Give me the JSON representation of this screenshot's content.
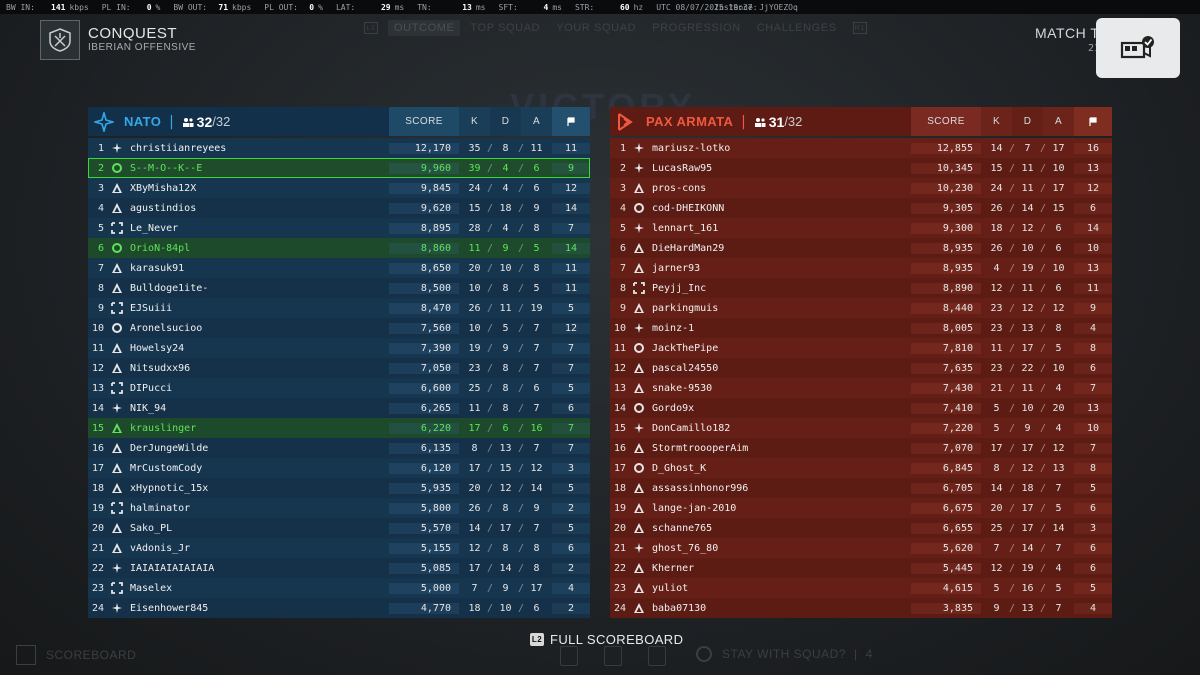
{
  "stats_bar": [
    {
      "label": "BW IN:",
      "value": "141",
      "unit": "kbps"
    },
    {
      "label": "PL IN:",
      "value": "0",
      "unit": "%"
    },
    {
      "label": "BW OUT:",
      "value": "71",
      "unit": "kbps"
    },
    {
      "label": "PL OUT:",
      "value": "0",
      "unit": "%"
    },
    {
      "label": "LAT:",
      "value": "29",
      "unit": "ms"
    },
    {
      "label": "TN:",
      "value": "13",
      "unit": "ms"
    },
    {
      "label": "SFT:",
      "value": "4",
      "unit": "ms"
    },
    {
      "label": "STR:",
      "value": "60",
      "unit": "hz"
    },
    {
      "label": "UTC 08/07/2025 19:37",
      "value": "",
      "unit": ""
    },
    {
      "label": "Instance:",
      "value": "",
      "unit": "JjYOEZOq"
    }
  ],
  "header": {
    "mode": "CONQUEST",
    "map": "IBERIAN OFFENSIVE",
    "match_time_label": "MATCH TI",
    "match_time_value": "21",
    "result": "VICTORY"
  },
  "tabs": [
    {
      "label": "OUTCOME",
      "active": true
    },
    {
      "label": "TOP SQUAD",
      "active": false
    },
    {
      "label": "YOUR SQUAD",
      "active": false
    },
    {
      "label": "PROGRESSION",
      "active": false
    },
    {
      "label": "CHALLENGES",
      "active": false
    }
  ],
  "columns": {
    "score": "SCORE",
    "k": "K",
    "d": "D",
    "a": "A"
  },
  "teams": {
    "nato": {
      "name": "NATO",
      "count_current": "32",
      "count_max": "/32",
      "accent": "#35a8ea",
      "players": [
        {
          "rank": "1",
          "name": "christiianreyees",
          "score": "12,170",
          "k": "35",
          "d": "8",
          "a": "11",
          "obj": "11",
          "cls": "support"
        },
        {
          "rank": "2",
          "name": "S--M-O--K--E",
          "score": "9,960",
          "k": "39",
          "d": "4",
          "a": "6",
          "obj": "9",
          "cls": "recon",
          "hl": "me"
        },
        {
          "rank": "3",
          "name": "XByMisha12X",
          "score": "9,845",
          "k": "24",
          "d": "4",
          "a": "6",
          "obj": "12",
          "cls": "assault"
        },
        {
          "rank": "4",
          "name": "agustindios",
          "score": "9,620",
          "k": "15",
          "d": "18",
          "a": "9",
          "obj": "14",
          "cls": "assault"
        },
        {
          "rank": "5",
          "name": "Le_Never",
          "score": "8,895",
          "k": "28",
          "d": "4",
          "a": "8",
          "obj": "7",
          "cls": "engineer"
        },
        {
          "rank": "6",
          "name": "OrioN-84pl",
          "score": "8,860",
          "k": "11",
          "d": "9",
          "a": "5",
          "obj": "14",
          "cls": "recon",
          "hl": "squad"
        },
        {
          "rank": "7",
          "name": "karasuk91",
          "score": "8,650",
          "k": "20",
          "d": "10",
          "a": "8",
          "obj": "11",
          "cls": "assault"
        },
        {
          "rank": "8",
          "name": "Bulldoge1ite-",
          "score": "8,500",
          "k": "10",
          "d": "8",
          "a": "5",
          "obj": "11",
          "cls": "assault"
        },
        {
          "rank": "9",
          "name": "EJSuiii",
          "score": "8,470",
          "k": "26",
          "d": "11",
          "a": "19",
          "obj": "5",
          "cls": "engineer"
        },
        {
          "rank": "10",
          "name": "Aronelsucioo",
          "score": "7,560",
          "k": "10",
          "d": "5",
          "a": "7",
          "obj": "12",
          "cls": "recon"
        },
        {
          "rank": "11",
          "name": "Howelsy24",
          "score": "7,390",
          "k": "19",
          "d": "9",
          "a": "7",
          "obj": "7",
          "cls": "assault"
        },
        {
          "rank": "12",
          "name": "Nitsudxx96",
          "score": "7,050",
          "k": "23",
          "d": "8",
          "a": "7",
          "obj": "7",
          "cls": "assault"
        },
        {
          "rank": "13",
          "name": "DIPucci",
          "score": "6,600",
          "k": "25",
          "d": "8",
          "a": "6",
          "obj": "5",
          "cls": "engineer"
        },
        {
          "rank": "14",
          "name": "NIK_94",
          "score": "6,265",
          "k": "11",
          "d": "8",
          "a": "7",
          "obj": "6",
          "cls": "support"
        },
        {
          "rank": "15",
          "name": "krauslinger",
          "score": "6,220",
          "k": "17",
          "d": "6",
          "a": "16",
          "obj": "7",
          "cls": "assault",
          "hl": "squad"
        },
        {
          "rank": "16",
          "name": "DerJungeWilde",
          "score": "6,135",
          "k": "8",
          "d": "13",
          "a": "7",
          "obj": "7",
          "cls": "assault"
        },
        {
          "rank": "17",
          "name": "MrCustomCody",
          "score": "6,120",
          "k": "17",
          "d": "15",
          "a": "12",
          "obj": "3",
          "cls": "assault"
        },
        {
          "rank": "18",
          "name": "xHypnotic_15x",
          "score": "5,935",
          "k": "20",
          "d": "12",
          "a": "14",
          "obj": "5",
          "cls": "assault"
        },
        {
          "rank": "19",
          "name": "halminator",
          "score": "5,800",
          "k": "26",
          "d": "8",
          "a": "9",
          "obj": "2",
          "cls": "engineer"
        },
        {
          "rank": "20",
          "name": "Sako_PL",
          "score": "5,570",
          "k": "14",
          "d": "17",
          "a": "7",
          "obj": "5",
          "cls": "assault"
        },
        {
          "rank": "21",
          "name": "vAdonis_Jr",
          "score": "5,155",
          "k": "12",
          "d": "8",
          "a": "8",
          "obj": "6",
          "cls": "assault"
        },
        {
          "rank": "22",
          "name": "IAIAIAIAIAIAIA",
          "score": "5,085",
          "k": "17",
          "d": "14",
          "a": "8",
          "obj": "2",
          "cls": "support"
        },
        {
          "rank": "23",
          "name": "Maselex",
          "score": "5,000",
          "k": "7",
          "d": "9",
          "a": "17",
          "obj": "4",
          "cls": "engineer"
        },
        {
          "rank": "24",
          "name": "Eisenhower845",
          "score": "4,770",
          "k": "18",
          "d": "10",
          "a": "6",
          "obj": "2",
          "cls": "support"
        }
      ]
    },
    "pax": {
      "name": "PAX ARMATA",
      "count_current": "31",
      "count_max": "/32",
      "accent": "#f0583f",
      "players": [
        {
          "rank": "1",
          "name": "mariusz-lotko",
          "score": "12,855",
          "k": "14",
          "d": "7",
          "a": "17",
          "obj": "16",
          "cls": "support"
        },
        {
          "rank": "2",
          "name": "LucasRaw95",
          "score": "10,345",
          "k": "15",
          "d": "11",
          "a": "10",
          "obj": "13",
          "cls": "support"
        },
        {
          "rank": "3",
          "name": "pros-cons",
          "score": "10,230",
          "k": "24",
          "d": "11",
          "a": "17",
          "obj": "12",
          "cls": "assault"
        },
        {
          "rank": "4",
          "name": "cod-DHEIKONN",
          "score": "9,305",
          "k": "26",
          "d": "14",
          "a": "15",
          "obj": "6",
          "cls": "recon"
        },
        {
          "rank": "5",
          "name": "lennart_161",
          "score": "9,300",
          "k": "18",
          "d": "12",
          "a": "6",
          "obj": "14",
          "cls": "support"
        },
        {
          "rank": "6",
          "name": "DieHardMan29",
          "score": "8,935",
          "k": "26",
          "d": "10",
          "a": "6",
          "obj": "10",
          "cls": "assault"
        },
        {
          "rank": "7",
          "name": "jarner93",
          "score": "8,935",
          "k": "4",
          "d": "19",
          "a": "10",
          "obj": "13",
          "cls": "assault"
        },
        {
          "rank": "8",
          "name": "Peyjj_Inc",
          "score": "8,890",
          "k": "12",
          "d": "11",
          "a": "6",
          "obj": "11",
          "cls": "engineer"
        },
        {
          "rank": "9",
          "name": "parkingmuis",
          "score": "8,440",
          "k": "23",
          "d": "12",
          "a": "12",
          "obj": "9",
          "cls": "assault"
        },
        {
          "rank": "10",
          "name": "moinz-1",
          "score": "8,005",
          "k": "23",
          "d": "13",
          "a": "8",
          "obj": "4",
          "cls": "support"
        },
        {
          "rank": "11",
          "name": "JackThePipe",
          "score": "7,810",
          "k": "11",
          "d": "17",
          "a": "5",
          "obj": "8",
          "cls": "recon"
        },
        {
          "rank": "12",
          "name": "pascal24550",
          "score": "7,635",
          "k": "23",
          "d": "22",
          "a": "10",
          "obj": "6",
          "cls": "assault"
        },
        {
          "rank": "13",
          "name": "snake-9530",
          "score": "7,430",
          "k": "21",
          "d": "11",
          "a": "4",
          "obj": "7",
          "cls": "assault"
        },
        {
          "rank": "14",
          "name": "Gordo9x",
          "score": "7,410",
          "k": "5",
          "d": "10",
          "a": "20",
          "obj": "13",
          "cls": "recon"
        },
        {
          "rank": "15",
          "name": "DonCamillo182",
          "score": "7,220",
          "k": "5",
          "d": "9",
          "a": "4",
          "obj": "10",
          "cls": "support"
        },
        {
          "rank": "16",
          "name": "StormtroooperAim",
          "score": "7,070",
          "k": "17",
          "d": "17",
          "a": "12",
          "obj": "7",
          "cls": "assault"
        },
        {
          "rank": "17",
          "name": "D_Ghost_K",
          "score": "6,845",
          "k": "8",
          "d": "12",
          "a": "13",
          "obj": "8",
          "cls": "recon"
        },
        {
          "rank": "18",
          "name": "assassinhonor996",
          "score": "6,705",
          "k": "14",
          "d": "18",
          "a": "7",
          "obj": "5",
          "cls": "assault"
        },
        {
          "rank": "19",
          "name": "lange-jan-2010",
          "score": "6,675",
          "k": "20",
          "d": "17",
          "a": "5",
          "obj": "6",
          "cls": "assault"
        },
        {
          "rank": "20",
          "name": "schanne765",
          "score": "6,655",
          "k": "25",
          "d": "17",
          "a": "14",
          "obj": "3",
          "cls": "assault"
        },
        {
          "rank": "21",
          "name": "ghost_76_80",
          "score": "5,620",
          "k": "7",
          "d": "14",
          "a": "7",
          "obj": "6",
          "cls": "support"
        },
        {
          "rank": "22",
          "name": "Kherner",
          "score": "5,445",
          "k": "12",
          "d": "19",
          "a": "4",
          "obj": "6",
          "cls": "assault"
        },
        {
          "rank": "23",
          "name": "yuliot",
          "score": "4,615",
          "k": "5",
          "d": "16",
          "a": "5",
          "obj": "5",
          "cls": "assault"
        },
        {
          "rank": "24",
          "name": "baba07130",
          "score": "3,835",
          "k": "9",
          "d": "13",
          "a": "7",
          "obj": "4",
          "cls": "assault"
        }
      ]
    }
  },
  "footer": {
    "l2_key": "L2",
    "full_scoreboard": "FULL SCOREBOARD",
    "scoreboard": "SCOREBOARD",
    "stay_with_squad": "STAY WITH SQUAD?",
    "stay_count": "4"
  },
  "colors": {
    "nato": "#35a8ea",
    "pax": "#f0583f",
    "squad_highlight": "#5fe35a"
  }
}
